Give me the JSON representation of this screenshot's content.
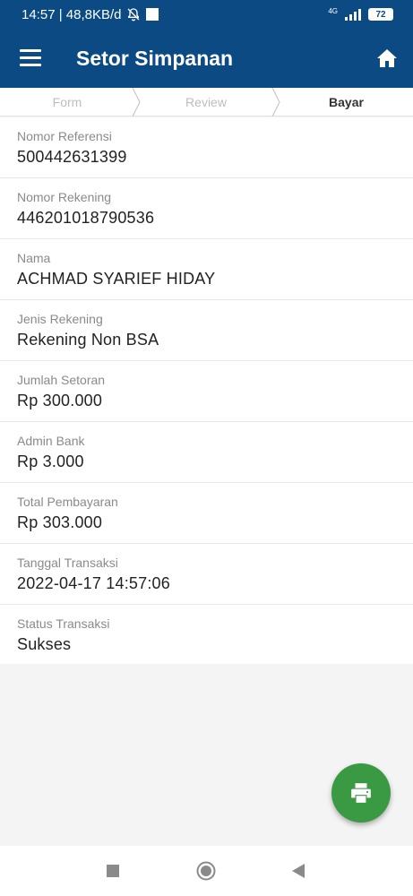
{
  "status_bar": {
    "time_speed": "14:57 | 48,8KB/d",
    "network": "4G",
    "battery": "72",
    "icons": [
      "bell-off-icon",
      "notification-square-icon",
      "signal-icon",
      "battery-icon"
    ]
  },
  "app_bar": {
    "title": "Setor Simpanan",
    "menu_icon": "menu-icon",
    "home_icon": "home-icon",
    "color": "#0b4a82"
  },
  "steps": [
    {
      "label": "Form",
      "active": false
    },
    {
      "label": "Review",
      "active": false
    },
    {
      "label": "Bayar",
      "active": true
    }
  ],
  "details": [
    {
      "label": "Nomor Referensi",
      "value": "500442631399"
    },
    {
      "label": "Nomor Rekening",
      "value": "446201018790536"
    },
    {
      "label": "Nama",
      "value": "ACHMAD SYARIEF HIDAY"
    },
    {
      "label": "Jenis Rekening",
      "value": "Rekening Non BSA"
    },
    {
      "label": "Jumlah Setoran",
      "value": "Rp 300.000"
    },
    {
      "label": "Admin Bank",
      "value": "Rp 3.000"
    },
    {
      "label": "Total Pembayaran",
      "value": "Rp 303.000"
    },
    {
      "label": "Tanggal Transaksi",
      "value": "2022-04-17 14:57:06"
    },
    {
      "label": "Status Transaksi",
      "value": "Sukses"
    }
  ],
  "fab": {
    "icon": "printer-icon",
    "color": "#3a9a44"
  },
  "nav_bar": {
    "icons": [
      "recents-icon",
      "home-circle-icon",
      "back-icon"
    ]
  }
}
